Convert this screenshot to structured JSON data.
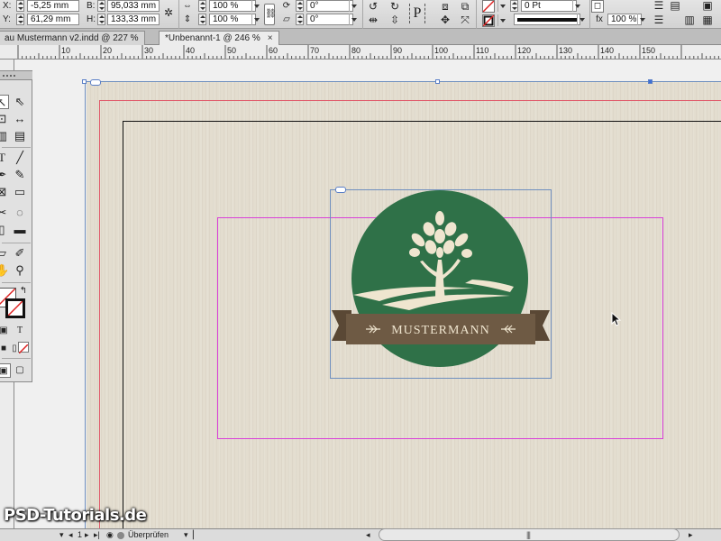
{
  "control_panel": {
    "x_label": "X:",
    "x_value": "-5,25 mm",
    "y_label": "Y:",
    "y_value": "61,29 mm",
    "w_label": "B:",
    "w_value": "95,033 mm",
    "h_label": "H:",
    "h_value": "133,33 mm",
    "scale_x_value": "100 %",
    "scale_y_value": "100 %",
    "rotate_value": "0°",
    "shear_value": "0°",
    "stroke_weight_value": "0 Pt",
    "opacity_value": "100 %",
    "text_frame_icon_label": "P"
  },
  "tabs": [
    {
      "label": "au Mustermann v2.indd @ 227 %"
    },
    {
      "label": "*Unbenannt-1 @ 246 %",
      "close": "×"
    }
  ],
  "ruler": {
    "numbers": [
      "10",
      "20",
      "30",
      "40",
      "50",
      "60",
      "70",
      "80",
      "90",
      "100",
      "110",
      "120",
      "130",
      "140",
      "150"
    ]
  },
  "logo": {
    "banner_text": "MUSTERMANN",
    "circle_color": "#2f7148",
    "banner_color": "#6e5a44",
    "cream_color": "#efe5cf"
  },
  "tools": {
    "icons": [
      "selection-tool",
      "direct-selection-tool",
      "page-tool",
      "gap-tool",
      "content-collector-tool",
      "content-placer-tool",
      "type-tool",
      "line-tool",
      "pen-tool",
      "pencil-tool",
      "rectangle-frame-tool",
      "rectangle-tool",
      "scissors-tool",
      "free-transform-tool",
      "gradient-swatch-tool",
      "gradient-feather-tool",
      "note-tool",
      "eyedropper-tool",
      "hand-tool",
      "zoom-tool"
    ]
  },
  "status": {
    "page_number": "1",
    "preflight_label": "Überprüfen"
  },
  "watermark": "PSD-Tutorials.de"
}
